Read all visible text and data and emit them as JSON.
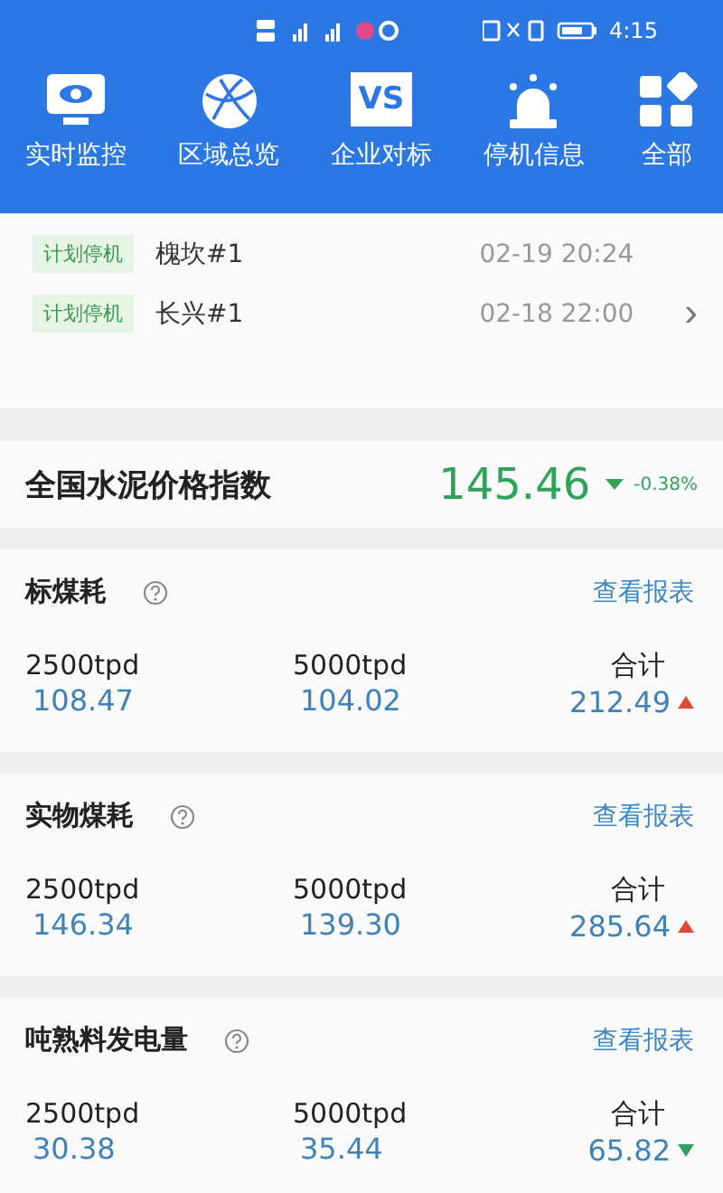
{
  "status_bar": {
    "time": "4:15"
  },
  "nav": [
    {
      "label": "实时监控",
      "kind": "monitor"
    },
    {
      "label": "区域总览",
      "kind": "globe"
    },
    {
      "label": "企业对标",
      "kind": "vs",
      "icon_text": "VS"
    },
    {
      "label": "停机信息",
      "kind": "alarm"
    },
    {
      "label": "全部",
      "kind": "grid"
    }
  ],
  "shutdowns": [
    {
      "tag": "计划停机",
      "plant": "槐坎#1",
      "time": "02-19 20:24"
    },
    {
      "tag": "计划停机",
      "plant": "长兴#1",
      "time": "02-18 22:00"
    }
  ],
  "chevron": "›",
  "price_index": {
    "title": "全国水泥价格指数",
    "value": "145.46",
    "rising": false,
    "change": "-0.38%"
  },
  "sections": [
    {
      "title": "标煤耗",
      "link": "查看报表",
      "cells": [
        {
          "label": "2500tpd",
          "value": "108.47"
        },
        {
          "label": "5000tpd",
          "value": "104.02"
        }
      ],
      "total_label": "合计",
      "total": "212.49",
      "rising": true
    },
    {
      "title": "实物煤耗",
      "link": "查看报表",
      "cells": [
        {
          "label": "2500tpd",
          "value": "146.34"
        },
        {
          "label": "5000tpd",
          "value": "139.30"
        }
      ],
      "total_label": "合计",
      "total": "285.64",
      "rising": true
    },
    {
      "title": "吨熟料发电量",
      "link": "查看报表",
      "cells": [
        {
          "label": "2500tpd",
          "value": "30.38"
        },
        {
          "label": "5000tpd",
          "value": "35.44"
        }
      ],
      "total_label": "合计",
      "total": "65.82",
      "rising": false
    }
  ]
}
